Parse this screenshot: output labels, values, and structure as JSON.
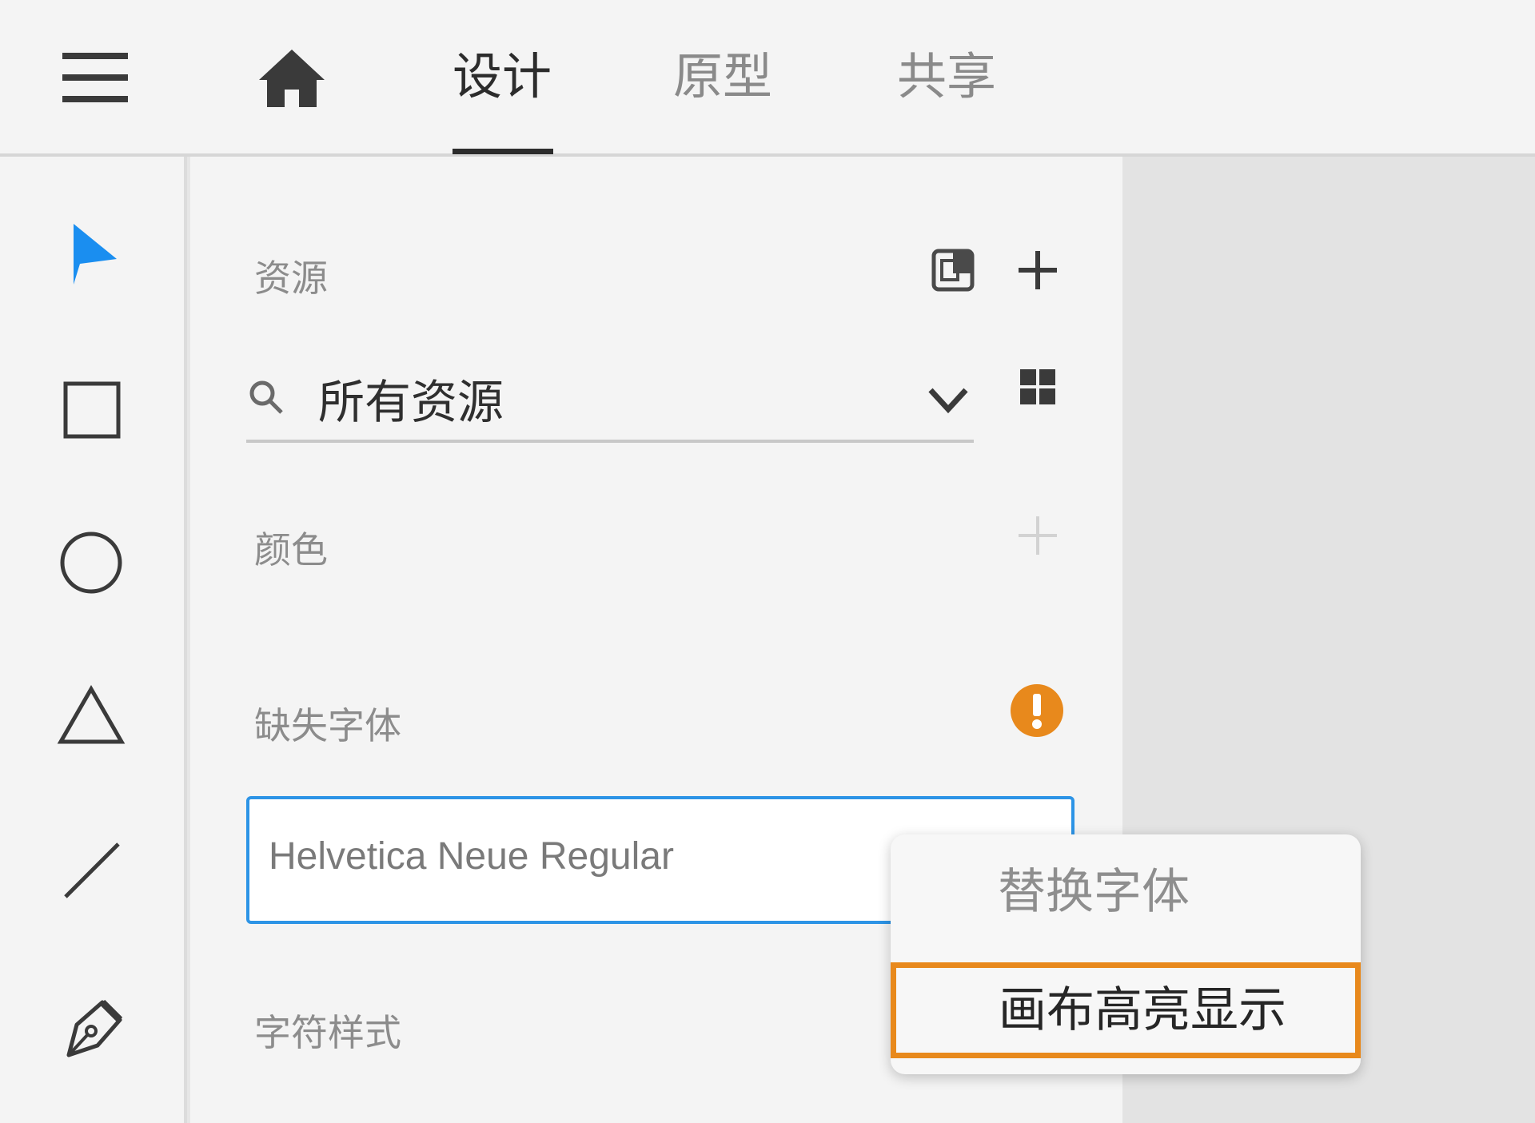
{
  "header": {
    "tabs": [
      {
        "label": "设计",
        "active": true
      },
      {
        "label": "原型",
        "active": false
      },
      {
        "label": "共享",
        "active": false
      }
    ],
    "icons": [
      "hamburger-menu-icon",
      "home-icon"
    ]
  },
  "toolbar": {
    "tools": [
      "select-arrow-icon",
      "rectangle-icon",
      "ellipse-icon",
      "triangle-icon",
      "line-icon",
      "pen-icon"
    ],
    "active_tool": "select-arrow-icon",
    "active_color": "#1a8ef0"
  },
  "assets_panel": {
    "title": "资源",
    "search": {
      "value": "所有资源"
    },
    "colors": {
      "title": "颜色"
    },
    "missing_fonts": {
      "title": "缺失字体",
      "warning_color": "#e8891c",
      "font_name": "Helvetica Neue Regular"
    },
    "character_styles": {
      "title": "字符样式"
    }
  },
  "context_menu": {
    "items": [
      {
        "label": "替换字体",
        "enabled": false
      },
      {
        "label": "画布高亮显示",
        "enabled": true,
        "highlighted": true
      }
    ],
    "highlight_color": "#e8891c"
  }
}
